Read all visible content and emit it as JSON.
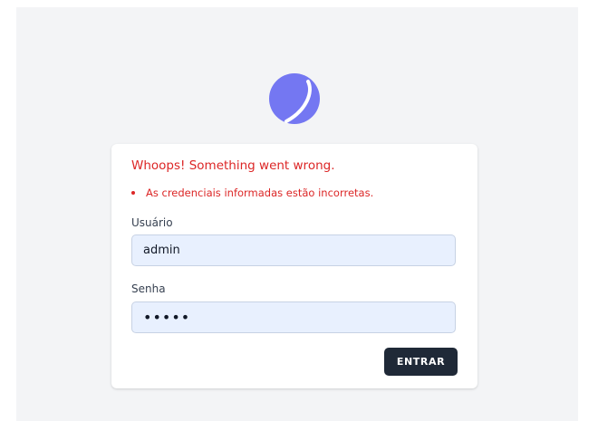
{
  "logo": {
    "icon": "moon-logo-icon",
    "color": "#7477f2"
  },
  "error": {
    "title": "Whoops! Something went wrong.",
    "items": [
      "As credenciais informadas estão incorretas."
    ],
    "color": "#dc2626"
  },
  "form": {
    "username": {
      "label": "Usuário",
      "value": "admin"
    },
    "password": {
      "label": "Senha",
      "value": "admin"
    },
    "submit_label": "ENTRAR"
  },
  "colors": {
    "page_bg": "#f3f4f6",
    "input_bg": "#e8f0fe",
    "button_bg": "#1f2937"
  }
}
